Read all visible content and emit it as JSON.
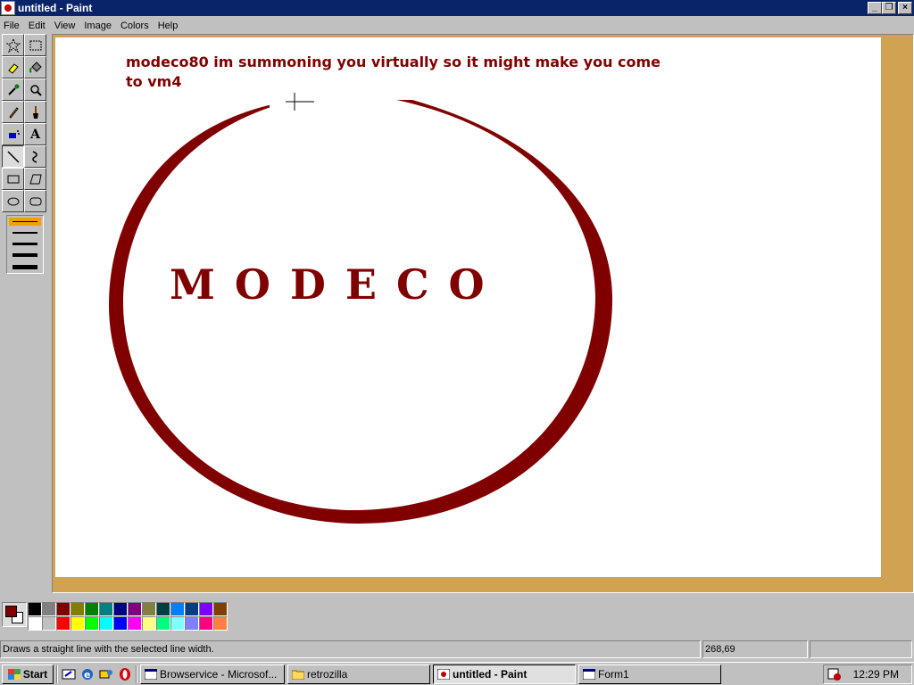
{
  "window": {
    "title": "untitled - Paint"
  },
  "menu": [
    "File",
    "Edit",
    "View",
    "Image",
    "Colors",
    "Help"
  ],
  "tools": [
    {
      "name": "free-form-select",
      "icon": "star-select-icon"
    },
    {
      "name": "select",
      "icon": "rect-select-icon"
    },
    {
      "name": "eraser",
      "icon": "eraser-icon"
    },
    {
      "name": "fill-with-color",
      "icon": "paint-bucket-icon"
    },
    {
      "name": "pick-color",
      "icon": "eyedropper-icon"
    },
    {
      "name": "magnifier",
      "icon": "magnifier-icon"
    },
    {
      "name": "pencil",
      "icon": "pencil-icon"
    },
    {
      "name": "brush",
      "icon": "brush-icon"
    },
    {
      "name": "airbrush",
      "icon": "airbrush-icon"
    },
    {
      "name": "text",
      "icon": "text-icon",
      "glyph": "A"
    },
    {
      "name": "line",
      "icon": "line-icon",
      "selected": true
    },
    {
      "name": "curve",
      "icon": "curve-icon"
    },
    {
      "name": "rectangle",
      "icon": "rectangle-icon"
    },
    {
      "name": "polygon",
      "icon": "polygon-icon"
    },
    {
      "name": "ellipse",
      "icon": "ellipse-icon"
    },
    {
      "name": "rounded-rectangle",
      "icon": "rounded-rectangle-icon"
    }
  ],
  "canvas": {
    "message": "modeco80 im summoning you virtually so it might make you come to vm4",
    "big_text": "MODECO",
    "art_color": "#800000"
  },
  "palette": {
    "foreground": "#800000",
    "background": "#ffffff",
    "row1": [
      "#000000",
      "#808080",
      "#800000",
      "#808000",
      "#008000",
      "#008080",
      "#000080",
      "#800080",
      "#808040",
      "#004040",
      "#0080ff",
      "#004080",
      "#8000ff",
      "#804000"
    ],
    "row2": [
      "#ffffff",
      "#c0c0c0",
      "#ff0000",
      "#ffff00",
      "#00ff00",
      "#00ffff",
      "#0000ff",
      "#ff00ff",
      "#ffff80",
      "#00ff80",
      "#80ffff",
      "#8080ff",
      "#ff0080",
      "#ff8040"
    ]
  },
  "status": {
    "help": "Draws a straight line with the selected line width.",
    "coords": "268,69",
    "size": ""
  },
  "taskbar": {
    "start": "Start",
    "tasks": [
      {
        "label": "Browservice - Microsof...",
        "active": false
      },
      {
        "label": "retrozilla",
        "active": false
      },
      {
        "label": "untitled - Paint",
        "active": true
      },
      {
        "label": "Form1",
        "active": false
      }
    ],
    "clock": "12:29 PM"
  }
}
